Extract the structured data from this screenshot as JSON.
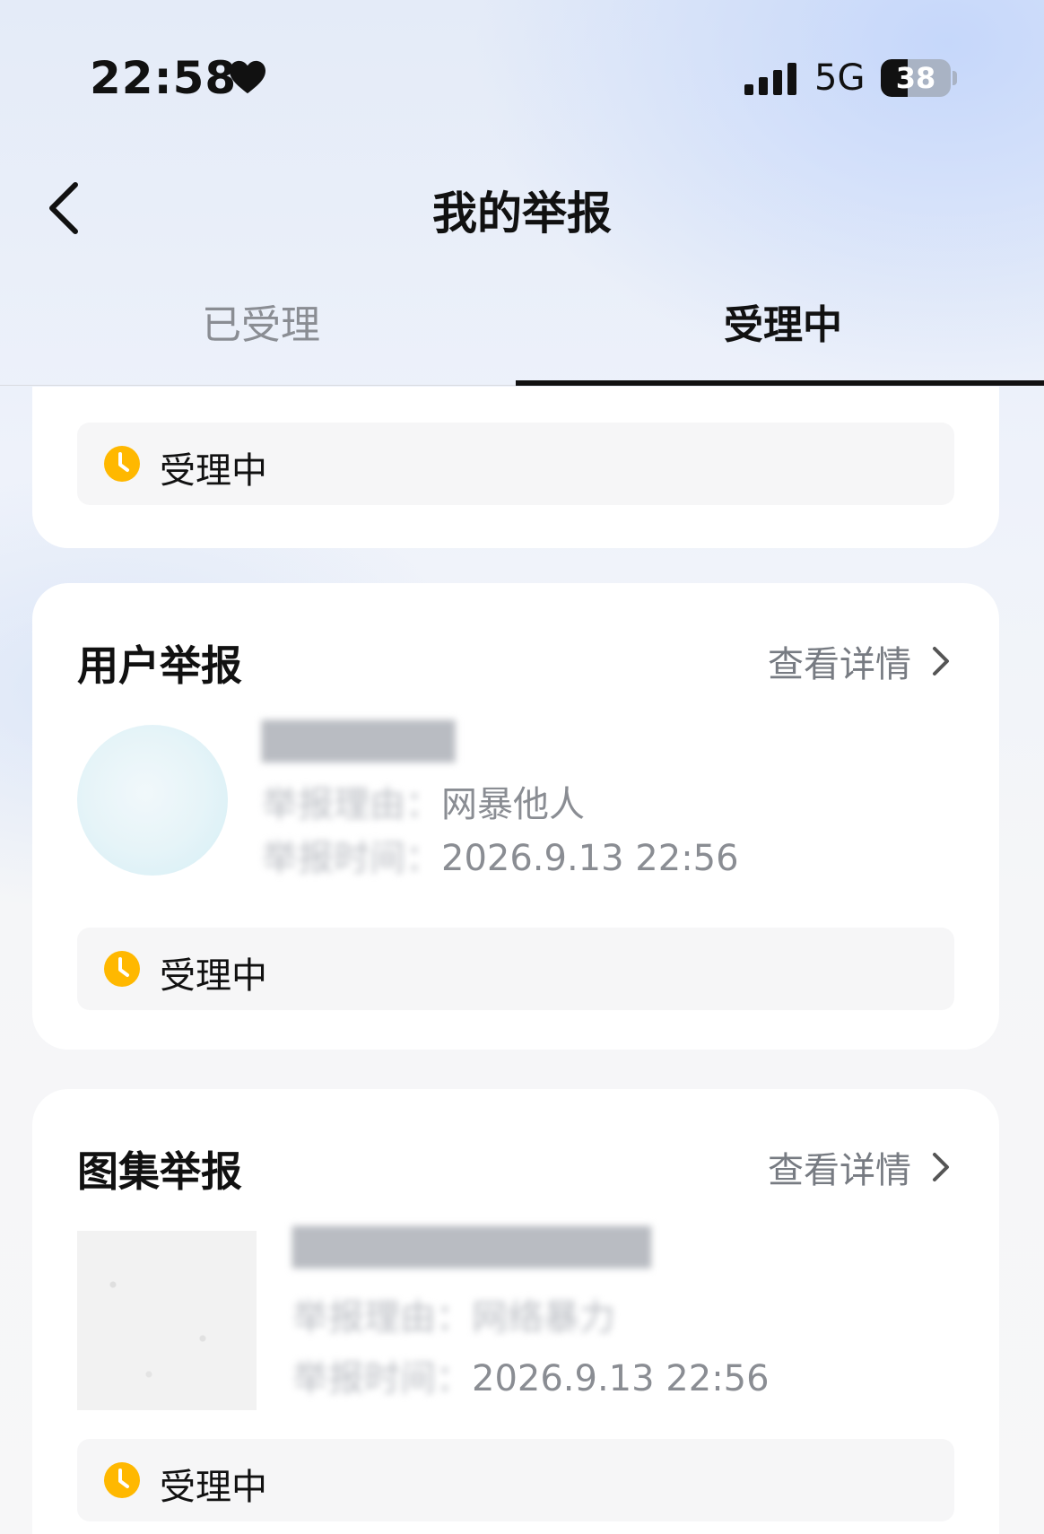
{
  "status_bar": {
    "time": "22:58",
    "network": "5G",
    "battery": "38",
    "battery_level": 0.38
  },
  "nav": {
    "title": "我的举报"
  },
  "tabs": [
    {
      "label": "已受理",
      "active": false
    },
    {
      "label": "受理中",
      "active": true
    }
  ],
  "cards": [
    {
      "status": "受理中"
    },
    {
      "title": "用户举报",
      "link": "查看详情",
      "name_blurred": "███████",
      "reason_label": "举报理由：",
      "reason": "网暴他人",
      "time_label": "举报时间：",
      "time": "2026.9.13 22:56",
      "status": "受理中"
    },
    {
      "title": "图集举报",
      "link": "查看详情",
      "name_blurred": "█████████████",
      "reason_label": "举报理由：",
      "reason": "网络暴力",
      "time_label": "举报时间：",
      "time": "2026.9.13 22:56",
      "status": "受理中"
    }
  ],
  "colors": {
    "accent": "#FFB800",
    "text": "#111111",
    "muted": "#8A8D93"
  }
}
